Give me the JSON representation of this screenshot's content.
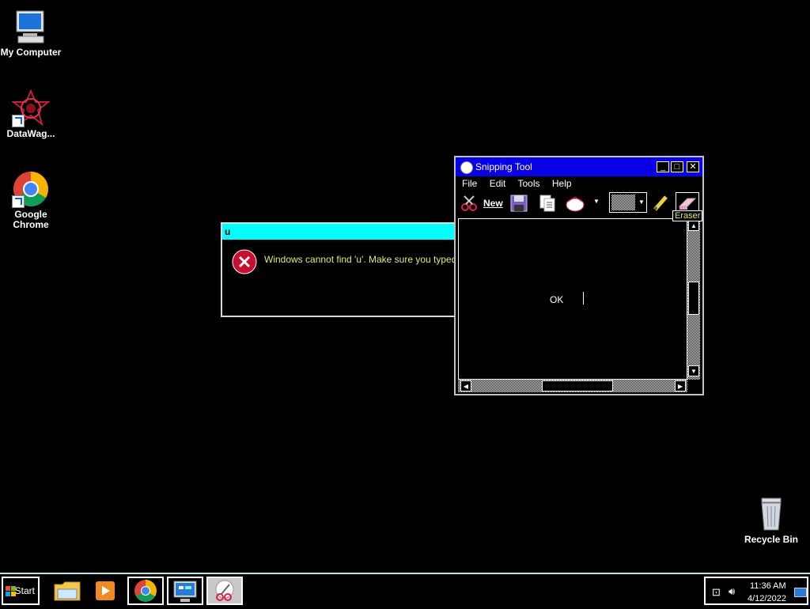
{
  "desktop": {
    "icons": [
      {
        "label": "My Computer"
      },
      {
        "label": "DataWag..."
      },
      {
        "label": "Google Chrome"
      },
      {
        "label": "Recycle Bin"
      }
    ]
  },
  "error_dialog": {
    "title": "u",
    "message": "Windows cannot find 'u'. Make sure you typed the r"
  },
  "snipping_tool": {
    "title": "Snipping Tool",
    "menu": [
      "File",
      "Edit",
      "Tools",
      "Help"
    ],
    "new_label": "New",
    "canvas_text": "OK",
    "tooltip": "Eraser"
  },
  "taskbar": {
    "start_label": "Start",
    "time": "11:36 AM",
    "date": "4/12/2022"
  },
  "colors": {
    "error_titlebar": "#00ffff",
    "snip_titlebar": "#0a00e6",
    "message_text": "#e8e86c"
  }
}
